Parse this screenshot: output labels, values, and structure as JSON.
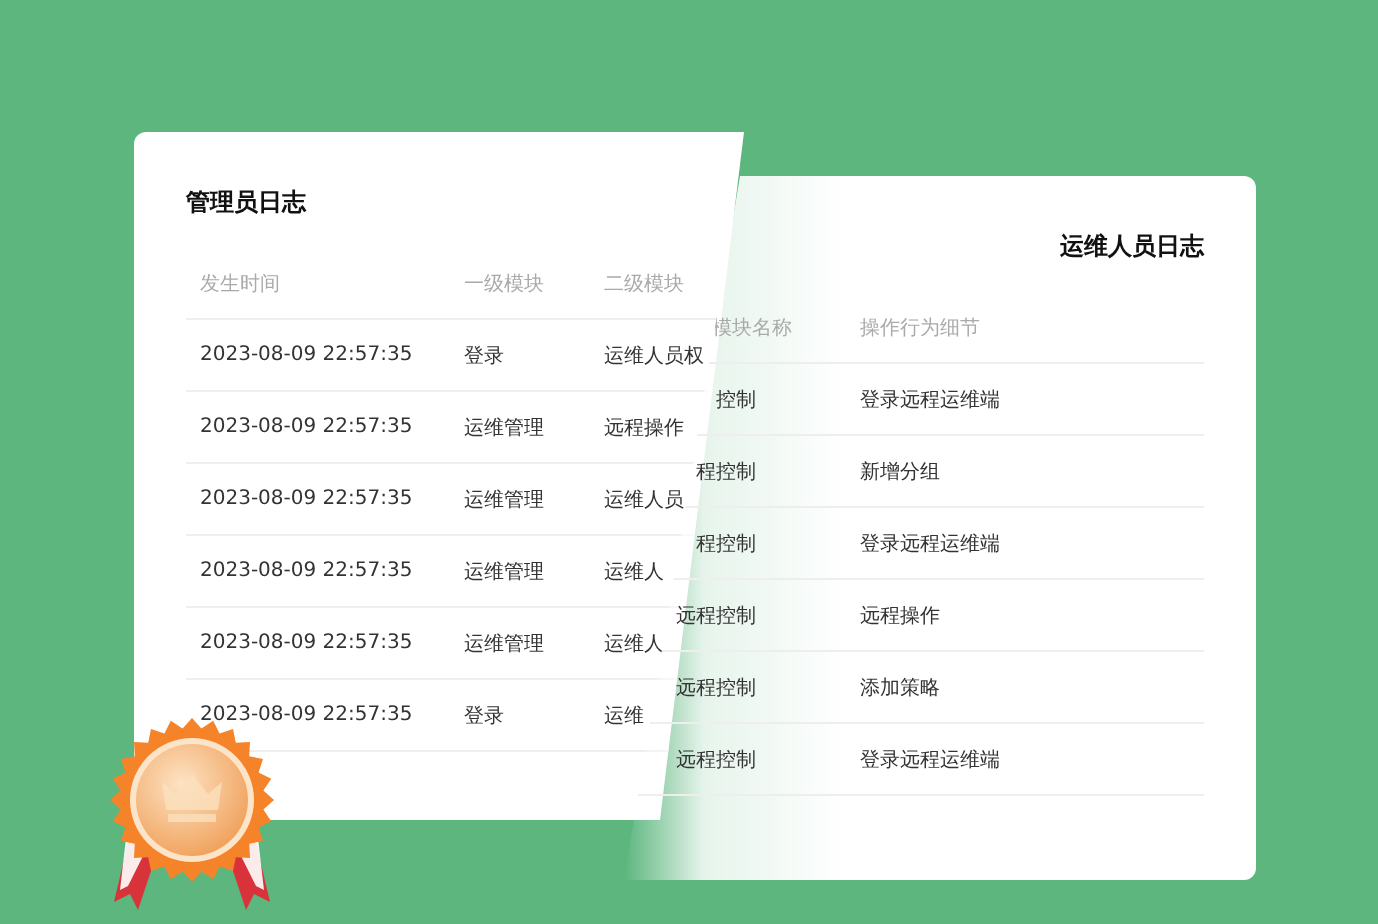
{
  "admin_log": {
    "title": "管理员日志",
    "columns": [
      "发生时间",
      "一级模块",
      "二级模块"
    ],
    "rows": [
      {
        "time": "2023-08-09 22:57:35",
        "module_1": "登录",
        "module_2": "运维人员权"
      },
      {
        "time": "2023-08-09 22:57:35",
        "module_1": "运维管理",
        "module_2": "远程操作"
      },
      {
        "time": "2023-08-09 22:57:35",
        "module_1": "运维管理",
        "module_2": "运维人员"
      },
      {
        "time": "2023-08-09 22:57:35",
        "module_1": "运维管理",
        "module_2": "运维人"
      },
      {
        "time": "2023-08-09 22:57:35",
        "module_1": "运维管理",
        "module_2": "运维人"
      },
      {
        "time": "2023-08-09 22:57:35",
        "module_1": "登录",
        "module_2": "运维"
      }
    ]
  },
  "ops_log": {
    "title": "运维人员日志",
    "columns": [
      "模块名称",
      "操作行为细节"
    ],
    "rows": [
      {
        "module": "控制",
        "action": "登录远程运维端"
      },
      {
        "module": "程控制",
        "action": "新增分组"
      },
      {
        "module": "程控制",
        "action": "登录远程运维端"
      },
      {
        "module": "远程控制",
        "action": "远程操作"
      },
      {
        "module": "远程控制",
        "action": "添加策略"
      },
      {
        "module": "远程控制",
        "action": "登录远程运维端"
      }
    ]
  }
}
